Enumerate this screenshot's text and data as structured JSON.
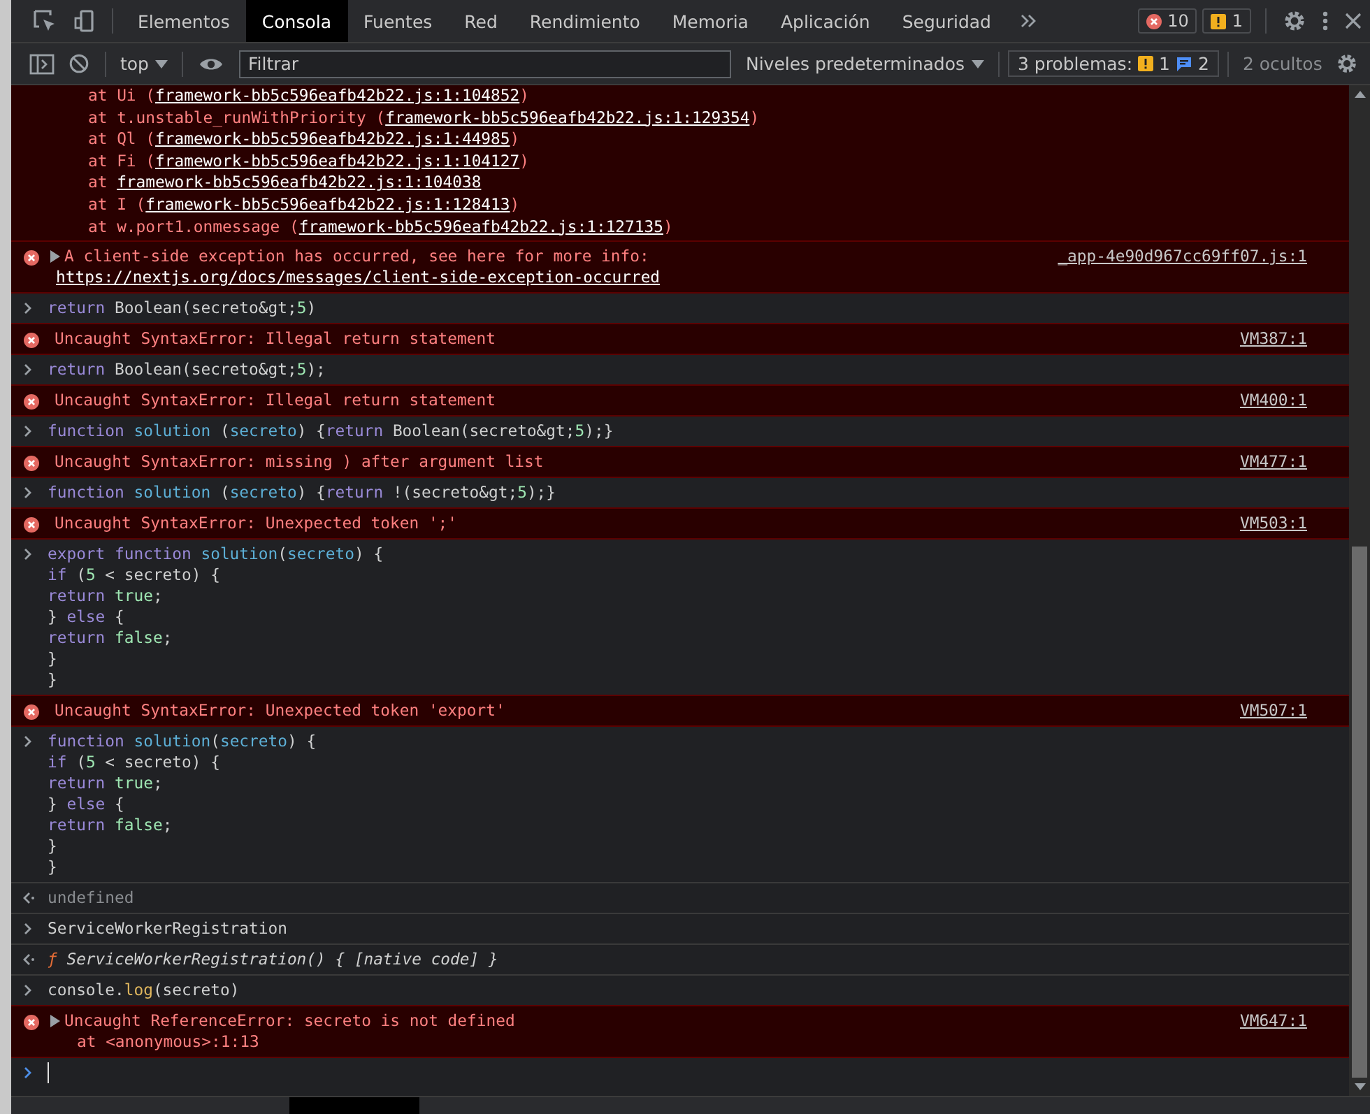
{
  "tabs": [
    {
      "label": "Elementos",
      "selected": false
    },
    {
      "label": "Consola",
      "selected": true
    },
    {
      "label": "Fuentes",
      "selected": false
    },
    {
      "label": "Red",
      "selected": false
    },
    {
      "label": "Rendimiento",
      "selected": false
    },
    {
      "label": "Memoria",
      "selected": false
    },
    {
      "label": "Aplicación",
      "selected": false
    },
    {
      "label": "Seguridad",
      "selected": false
    }
  ],
  "counts": {
    "errors": "10",
    "warnings": "1"
  },
  "toolbar": {
    "context": "top",
    "filter_placeholder": "Filtrar",
    "levels": "Niveles predeterminados",
    "issues_label": "3 problemas:",
    "issues_warnings": "1",
    "issues_info": "2",
    "hidden": "2 ocultos"
  },
  "entries": [
    {
      "kind": "stack",
      "lines": [
        {
          "text": "at Ui (",
          "link": "framework-bb5c596eafb42b22.js:1:104852",
          "after": ")"
        },
        {
          "text": "at t.unstable_runWithPriority (",
          "link": "framework-bb5c596eafb42b22.js:1:129354",
          "after": ")"
        },
        {
          "text": "at Ql (",
          "link": "framework-bb5c596eafb42b22.js:1:44985",
          "after": ")"
        },
        {
          "text": "at Fi (",
          "link": "framework-bb5c596eafb42b22.js:1:104127",
          "after": ")"
        },
        {
          "text": "at ",
          "link": "framework-bb5c596eafb42b22.js:1:104038"
        },
        {
          "text": "at I (",
          "link": "framework-bb5c596eafb42b22.js:1:128413",
          "after": ")"
        },
        {
          "text": "at w.port1.onmessage (",
          "link": "framework-bb5c596eafb42b22.js:1:127135",
          "after": ")"
        }
      ]
    },
    {
      "kind": "error",
      "expandable": true,
      "message": "A client-side exception has occurred, see here for more info: ",
      "link": "https://nextjs.org/docs/messages/client-side-exception-occurred",
      "source": "_app-4e90d967cc69ff07.js:1"
    },
    {
      "kind": "input",
      "lines": [
        [
          {
            "kind": "kw",
            "text": "return "
          },
          {
            "kind": "pl",
            "text": "Boolean(secreto&gt;"
          },
          {
            "kind": "num",
            "text": "5"
          },
          {
            "kind": "pl",
            "text": ")"
          }
        ]
      ]
    },
    {
      "kind": "error",
      "message": "Uncaught SyntaxError: Illegal return statement",
      "source": "VM387:1"
    },
    {
      "kind": "input",
      "lines": [
        [
          {
            "kind": "kw",
            "text": "return "
          },
          {
            "kind": "pl",
            "text": "Boolean(secreto&gt;"
          },
          {
            "kind": "num",
            "text": "5"
          },
          {
            "kind": "pl",
            "text": ");"
          }
        ]
      ]
    },
    {
      "kind": "error",
      "message": "Uncaught SyntaxError: Illegal return statement",
      "source": "VM400:1"
    },
    {
      "kind": "input",
      "lines": [
        [
          {
            "kind": "kw",
            "text": "function "
          },
          {
            "kind": "def",
            "text": "solution "
          },
          {
            "kind": "pl",
            "text": "("
          },
          {
            "kind": "def",
            "text": "secreto"
          },
          {
            "kind": "pl",
            "text": ") {"
          },
          {
            "kind": "kw",
            "text": "return "
          },
          {
            "kind": "pl",
            "text": "Boolean(secreto&gt;"
          },
          {
            "kind": "num",
            "text": "5"
          },
          {
            "kind": "pl",
            "text": ");}"
          }
        ]
      ]
    },
    {
      "kind": "error",
      "message": "Uncaught SyntaxError: missing ) after argument list",
      "source": "VM477:1"
    },
    {
      "kind": "input",
      "lines": [
        [
          {
            "kind": "kw",
            "text": "function "
          },
          {
            "kind": "def",
            "text": "solution "
          },
          {
            "kind": "pl",
            "text": "("
          },
          {
            "kind": "def",
            "text": "secreto"
          },
          {
            "kind": "pl",
            "text": ") {"
          },
          {
            "kind": "kw",
            "text": "return "
          },
          {
            "kind": "pl",
            "text": "!(secreto&gt;"
          },
          {
            "kind": "num",
            "text": "5"
          },
          {
            "kind": "pl",
            "text": ");}"
          }
        ]
      ]
    },
    {
      "kind": "error",
      "message": "Uncaught SyntaxError: Unexpected token ';'",
      "source": "VM503:1"
    },
    {
      "kind": "input",
      "lines": [
        [
          {
            "kind": "kw",
            "text": "export function "
          },
          {
            "kind": "def",
            "text": "solution"
          },
          {
            "kind": "pl",
            "text": "("
          },
          {
            "kind": "def",
            "text": "secreto"
          },
          {
            "kind": "pl",
            "text": ") {"
          }
        ],
        [
          {
            "kind": "kw",
            "text": "if "
          },
          {
            "kind": "pl",
            "text": "("
          },
          {
            "kind": "num",
            "text": "5"
          },
          {
            "kind": "pl",
            "text": " < secreto) {"
          }
        ],
        [
          {
            "kind": "kw",
            "text": "return "
          },
          {
            "kind": "num",
            "text": "true"
          },
          {
            "kind": "pl",
            "text": ";"
          }
        ],
        [
          {
            "kind": "pl",
            "text": "} "
          },
          {
            "kind": "kw",
            "text": "else "
          },
          {
            "kind": "pl",
            "text": "{"
          }
        ],
        [
          {
            "kind": "kw",
            "text": "return "
          },
          {
            "kind": "num",
            "text": "false"
          },
          {
            "kind": "pl",
            "text": ";"
          }
        ],
        [
          {
            "kind": "pl",
            "text": "}"
          }
        ],
        [
          {
            "kind": "pl",
            "text": "}"
          }
        ]
      ]
    },
    {
      "kind": "error",
      "message": "Uncaught SyntaxError: Unexpected token 'export'",
      "source": "VM507:1"
    },
    {
      "kind": "input",
      "lines": [
        [
          {
            "kind": "kw",
            "text": "function "
          },
          {
            "kind": "def",
            "text": "solution"
          },
          {
            "kind": "pl",
            "text": "("
          },
          {
            "kind": "def",
            "text": "secreto"
          },
          {
            "kind": "pl",
            "text": ") {"
          }
        ],
        [
          {
            "kind": "kw",
            "text": "if "
          },
          {
            "kind": "pl",
            "text": "("
          },
          {
            "kind": "num",
            "text": "5"
          },
          {
            "kind": "pl",
            "text": " < secreto) {"
          }
        ],
        [
          {
            "kind": "kw",
            "text": "return "
          },
          {
            "kind": "num",
            "text": "true"
          },
          {
            "kind": "pl",
            "text": ";"
          }
        ],
        [
          {
            "kind": "pl",
            "text": "} "
          },
          {
            "kind": "kw",
            "text": "else "
          },
          {
            "kind": "pl",
            "text": "{"
          }
        ],
        [
          {
            "kind": "kw",
            "text": "return "
          },
          {
            "kind": "num",
            "text": "false"
          },
          {
            "kind": "pl",
            "text": ";"
          }
        ],
        [
          {
            "kind": "pl",
            "text": "}"
          }
        ],
        [
          {
            "kind": "pl",
            "text": "}"
          }
        ]
      ]
    },
    {
      "kind": "output",
      "lines": [
        [
          {
            "kind": "dim",
            "text": "undefined"
          }
        ]
      ]
    },
    {
      "kind": "input",
      "lines": [
        [
          {
            "kind": "pl",
            "text": "ServiceWorkerRegistration"
          }
        ]
      ]
    },
    {
      "kind": "output",
      "lines": [
        [
          {
            "kind": "fn",
            "text": "ƒ "
          },
          {
            "kind": "it",
            "text": "ServiceWorkerRegistration() { [native code] }"
          }
        ]
      ]
    },
    {
      "kind": "input",
      "lines": [
        [
          {
            "kind": "pl",
            "text": "console."
          },
          {
            "kind": "meth",
            "text": "log"
          },
          {
            "kind": "pl",
            "text": "(secreto)"
          }
        ]
      ]
    },
    {
      "kind": "error",
      "expandable": true,
      "message": "Uncaught ReferenceError: secreto is not defined",
      "trace": "at <anonymous>:1:13",
      "source": "VM647:1"
    },
    {
      "kind": "prompt"
    }
  ]
}
